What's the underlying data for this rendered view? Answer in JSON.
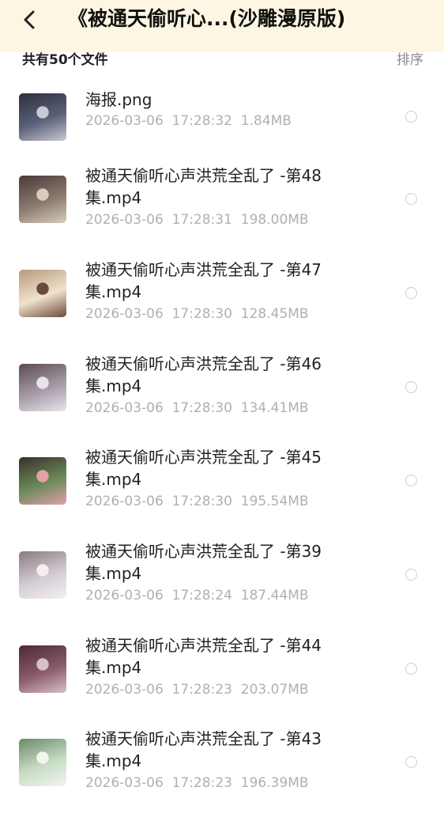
{
  "header": {
    "title": "《被通天偷听心...(沙雕漫原版)",
    "back_icon": "chevron-left-icon"
  },
  "toolbar": {
    "count_label": "共有50个文件",
    "sort_label": "排序"
  },
  "files": [
    {
      "name_line1": "海报.png",
      "name_line2": "",
      "date": "2026-03-06",
      "time": "17:28:32",
      "size": "1.84MB",
      "thumb_colors": [
        "#2b2f3c",
        "#5a6078",
        "#c9c9d4"
      ]
    },
    {
      "name_line1": "被通天偷听心声洪荒全乱了 -第48",
      "name_line2": "集.mp4",
      "date": "2026-03-06",
      "time": "17:28:31",
      "size": "198.00MB",
      "thumb_colors": [
        "#4a3a3a",
        "#8a7a6e",
        "#d8cdbd"
      ]
    },
    {
      "name_line1": "被通天偷听心声洪荒全乱了 -第47",
      "name_line2": "集.mp4",
      "date": "2026-03-06",
      "time": "17:28:30",
      "size": "128.45MB",
      "thumb_colors": [
        "#b59a7a",
        "#f0e2cc",
        "#6a4a3a"
      ]
    },
    {
      "name_line1": "被通天偷听心声洪荒全乱了 -第46",
      "name_line2": "集.mp4",
      "date": "2026-03-06",
      "time": "17:28:30",
      "size": "134.41MB",
      "thumb_colors": [
        "#5c4a52",
        "#a69ca8",
        "#e8e4ec"
      ]
    },
    {
      "name_line1": "被通天偷听心声洪荒全乱了 -第45",
      "name_line2": "集.mp4",
      "date": "2026-03-06",
      "time": "17:28:30",
      "size": "195.54MB",
      "thumb_colors": [
        "#3a2e2a",
        "#6a8a5a",
        "#e2a0a8"
      ]
    },
    {
      "name_line1": "被通天偷听心声洪荒全乱了 -第39",
      "name_line2": "集.mp4",
      "date": "2026-03-06",
      "time": "17:28:24",
      "size": "187.44MB",
      "thumb_colors": [
        "#8a7a80",
        "#d4ccd4",
        "#f4f0f2"
      ]
    },
    {
      "name_line1": "被通天偷听心声洪荒全乱了 -第44",
      "name_line2": "集.mp4",
      "date": "2026-03-06",
      "time": "17:28:23",
      "size": "203.07MB",
      "thumb_colors": [
        "#4a2a32",
        "#8a5a6a",
        "#d8c0c8"
      ]
    },
    {
      "name_line1": "被通天偷听心声洪荒全乱了 -第43",
      "name_line2": "集.mp4",
      "date": "2026-03-06",
      "time": "17:28:23",
      "size": "196.39MB",
      "thumb_colors": [
        "#6a8a6a",
        "#c8dcc4",
        "#f2f4ee"
      ]
    }
  ]
}
